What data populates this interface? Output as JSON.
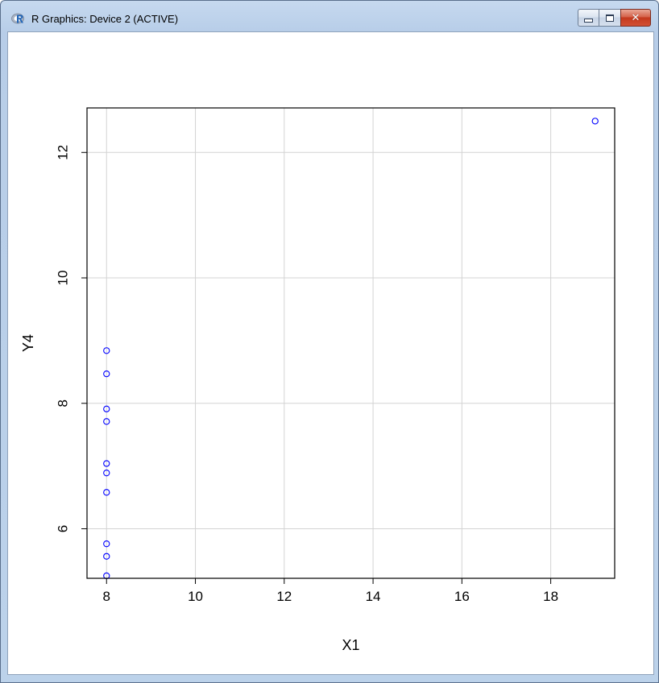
{
  "window": {
    "title": "R Graphics: Device 2 (ACTIVE)",
    "icon": "r-logo-icon",
    "buttons": {
      "minimize": "minimize-icon",
      "maximize": "maximize-icon",
      "close": "close-icon",
      "close_symbol": "✕"
    }
  },
  "chart_data": {
    "type": "scatter",
    "xlabel": "X1",
    "ylabel": "Y4",
    "xlim": [
      7.56,
      19.44
    ],
    "ylim": [
      5.21,
      12.71
    ],
    "xticks": [
      8,
      10,
      12,
      14,
      16,
      18
    ],
    "yticks": [
      6,
      8,
      10,
      12
    ],
    "grid": true,
    "grid_color": "#d3d3d3",
    "point_color": "#0000ff",
    "marker": "open-circle",
    "x": [
      8,
      8,
      8,
      8,
      8,
      8,
      8,
      8,
      8,
      8,
      19
    ],
    "y": [
      6.58,
      5.76,
      7.71,
      8.84,
      8.47,
      7.04,
      5.25,
      5.56,
      7.91,
      6.89,
      12.5
    ]
  }
}
